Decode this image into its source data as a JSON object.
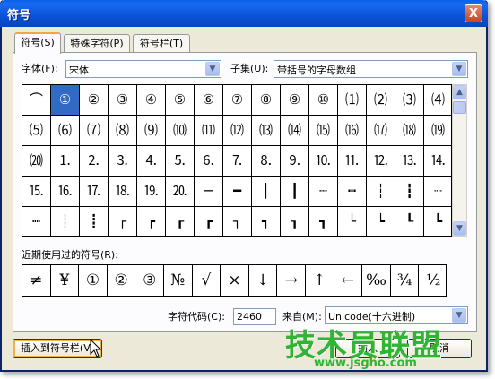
{
  "window": {
    "title": "符号",
    "close": "X"
  },
  "tabs": [
    {
      "label": "符号(S)"
    },
    {
      "label": "特殊字符(P)"
    },
    {
      "label": "符号栏(T)"
    }
  ],
  "font": {
    "label": "字体(F):",
    "value": "宋体"
  },
  "subset": {
    "label": "子集(U):",
    "value": "带括号的字母数组"
  },
  "symbol_rows": [
    [
      "⌒",
      "①",
      "②",
      "③",
      "④",
      "⑤",
      "⑥",
      "⑦",
      "⑧",
      "⑨",
      "⑩",
      "⑴",
      "⑵",
      "⑶",
      "⑷"
    ],
    [
      "⑸",
      "⑹",
      "⑺",
      "⑻",
      "⑼",
      "⑽",
      "⑾",
      "⑿",
      "⒀",
      "⒁",
      "⒂",
      "⒃",
      "⒄",
      "⒅",
      "⒆"
    ],
    [
      "⒇",
      "⒈",
      "⒉",
      "⒊",
      "⒋",
      "⒌",
      "⒍",
      "⒎",
      "⒏",
      "⒐",
      "⒑",
      "⒒",
      "⒓",
      "⒔",
      "⒕"
    ],
    [
      "⒖",
      "⒗",
      "⒘",
      "⒙",
      "⒚",
      "⒛",
      "─",
      "━",
      "│",
      "┃",
      "┄",
      "┅",
      "┆",
      "┇",
      "┈"
    ],
    [
      "┉",
      "┊",
      "┋",
      "┌",
      "┍",
      "┎",
      "┏",
      "┐",
      "┑",
      "┒",
      "┓",
      "└",
      "┕",
      "┖",
      "┗"
    ]
  ],
  "selected_symbol": "①",
  "recent": {
    "label": "近期使用过的符号(R):",
    "items": [
      "≠",
      "¥",
      "①",
      "②",
      "③",
      "№",
      "√",
      "×",
      "↓",
      "→",
      "↑",
      "←",
      "‰",
      "¾",
      "½"
    ]
  },
  "char_code": {
    "label": "字符代码(C):",
    "value": "2460"
  },
  "from": {
    "label": "来自(M):",
    "value": "Unicode(十六进制)"
  },
  "buttons": {
    "insert_to_bar": "插入到符号栏(V)",
    "insert": "插入",
    "cancel": "取消"
  },
  "watermark": {
    "text": "技术员联盟",
    "url": "www.jsgho.com"
  },
  "colors": {
    "titlebar": "#0a52d6",
    "selection": "#316ac5",
    "tab_highlight": "#f3a541",
    "watermark": "#2fb434"
  }
}
